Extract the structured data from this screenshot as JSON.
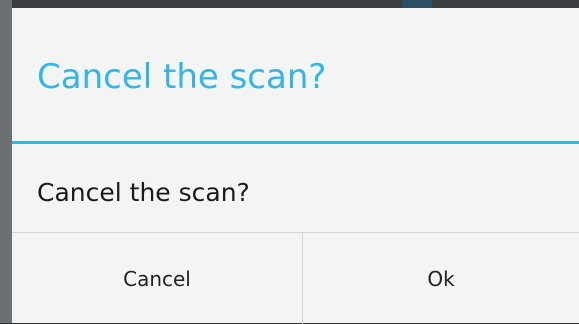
{
  "dialog": {
    "title": "Cancel the scan?",
    "message": "Cancel the scan?",
    "buttons": {
      "cancel_label": "Cancel",
      "ok_label": "Ok"
    }
  },
  "colors": {
    "accent": "#33b5e5",
    "dialog_background": "#f3f4f4"
  }
}
